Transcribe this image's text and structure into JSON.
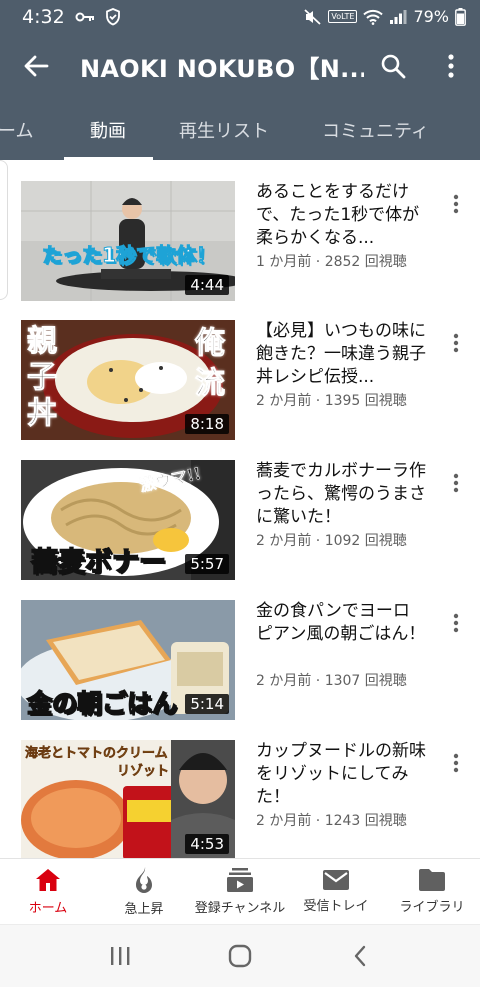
{
  "status_bar": {
    "time": "4:32",
    "battery": "79%",
    "network_badge": "VoLTE"
  },
  "app_bar": {
    "title": "NAOKI NOKUBO【N..."
  },
  "tabs": [
    {
      "label": "ーム",
      "active": false
    },
    {
      "label": "動画",
      "active": true
    },
    {
      "label": "再生リスト",
      "active": false
    },
    {
      "label": "コミュニティ",
      "active": false
    }
  ],
  "videos": [
    {
      "title": "あることをするだけで、たった1秒で体が柔らかくなる...",
      "meta": "1 か月前 · 2852 回視聴",
      "duration": "4:44",
      "thumb_text": "たった1秒で軟体！"
    },
    {
      "title": "【必見】いつもの味に飽きた？一味違う親子丼レシピ伝授...",
      "meta": "2 か月前 · 1395 回視聴",
      "duration": "8:18",
      "thumb_text_left": "親子丼",
      "thumb_text_right": "俺流"
    },
    {
      "title": "蕎麦でカルボナーラ作ったら、驚愕のうまさに驚いた！",
      "meta": "2 か月前 · 1092 回視聴",
      "duration": "5:57",
      "thumb_text": "蕎麦ボナー",
      "thumb_text_small": "激ウマ!!"
    },
    {
      "title": "金の食パンでヨーロピアン風の朝ごはん！",
      "meta": "2 か月前 · 1307 回視聴",
      "duration": "5:14",
      "thumb_text": "金の朝ごはん"
    },
    {
      "title": "カップヌードルの新味をリゾットにしてみた！",
      "meta": "2 か月前 · 1243 回視聴",
      "duration": "4:53",
      "thumb_text": "海老とトマトのクリーム",
      "thumb_text_2": "リゾット"
    }
  ],
  "bottom_nav": [
    {
      "label": "ホーム",
      "icon": "home-icon",
      "active": true
    },
    {
      "label": "急上昇",
      "icon": "trending-icon",
      "active": false
    },
    {
      "label": "登録チャンネル",
      "icon": "subscriptions-icon",
      "active": false
    },
    {
      "label": "受信トレイ",
      "icon": "inbox-icon",
      "active": false
    },
    {
      "label": "ライブラリ",
      "icon": "library-icon",
      "active": false
    }
  ],
  "colors": {
    "header_bg": "#4f5d6b",
    "active_red": "#d9000f"
  }
}
